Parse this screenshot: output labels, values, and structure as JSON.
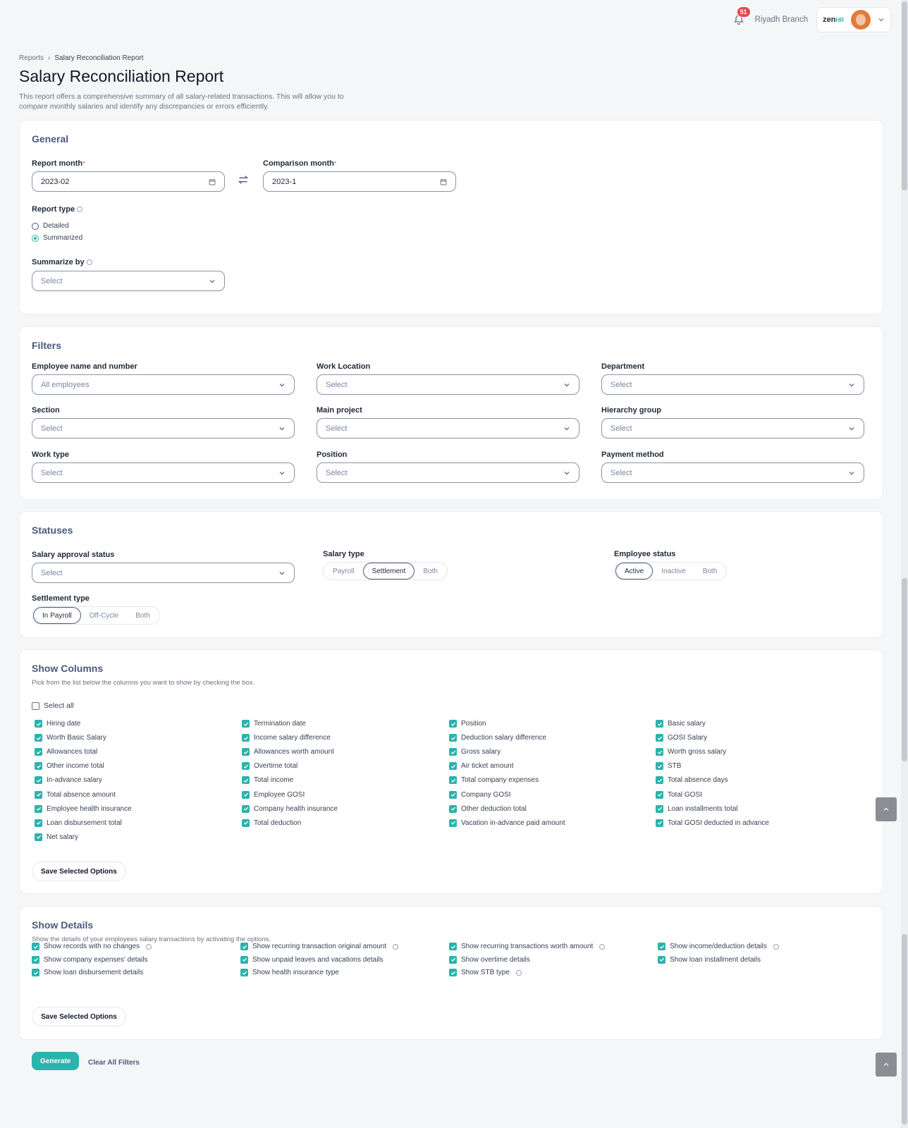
{
  "header": {
    "notif_count": "51",
    "branch": "Riyadh Branch",
    "logo_main": "zen",
    "logo_accent": "HR"
  },
  "breadcrumb": {
    "root": "Reports",
    "current": "Salary Reconciliation Report"
  },
  "page": {
    "title": "Salary Reconciliation Report",
    "description": "This report offers a comprehensive summary of all salary-related transactions. This will allow you to compare monthly salaries and identify any discrepancies or errors efficiently."
  },
  "general": {
    "title": "General",
    "report_month_label": "Report month",
    "report_month_value": "2023-02",
    "comparison_month_label": "Comparison month",
    "comparison_month_value": "2023-1",
    "report_type_label": "Report type",
    "report_type_options": [
      "Detailed",
      "Summarized"
    ],
    "report_type_selected": "Summarized",
    "summarize_by_label": "Summarize by",
    "summarize_by_value": "Select"
  },
  "filters": {
    "title": "Filters",
    "fields": [
      {
        "label": "Employee name and number",
        "value": "All employees"
      },
      {
        "label": "Work Location",
        "value": "Select"
      },
      {
        "label": "Department",
        "value": "Select"
      },
      {
        "label": "Section",
        "value": "Select"
      },
      {
        "label": "Main project",
        "value": "Select"
      },
      {
        "label": "Hierarchy group",
        "value": "Select"
      },
      {
        "label": "Work type",
        "value": "Select"
      },
      {
        "label": "Position",
        "value": "Select"
      },
      {
        "label": "Payment method",
        "value": "Select"
      }
    ]
  },
  "statuses": {
    "title": "Statuses",
    "salary_approval_label": "Salary approval status",
    "salary_approval_value": "Select",
    "salary_type_label": "Salary type",
    "salary_type_options": [
      "Payroll",
      "Settlement",
      "Both"
    ],
    "salary_type_selected": "Settlement",
    "employee_status_label": "Employee status",
    "employee_status_options": [
      "Active",
      "Inactive",
      "Both"
    ],
    "employee_status_selected": "Active",
    "settlement_type_label": "Settlement type",
    "settlement_type_options": [
      "In Payroll",
      "Off-Cycle",
      "Both"
    ],
    "settlement_type_selected": "In Payroll"
  },
  "show_columns": {
    "title": "Show Columns",
    "subtitle": "Pick from the list below the columns you want to show by checking the box.",
    "select_all_label": "Select all",
    "columns": [
      [
        "Hiring date",
        "Worth Basic Salary",
        "Allowances total",
        "Other income total",
        "In-advance salary",
        "Total absence amount",
        "Employee health insurance",
        "Loan disbursement total",
        "Net salary"
      ],
      [
        "Termination date",
        "Income salary difference",
        "Allowances worth amount",
        "Overtime total",
        "Total income",
        "Employee GOSI",
        "Company health insurance",
        "Total deduction"
      ],
      [
        "Position",
        "Deduction salary difference",
        "Gross salary",
        "Air ticket amount",
        "Total company expenses",
        "Company GOSI",
        "Other deduction total",
        "Vacation in-advance paid amount"
      ],
      [
        "Basic salary",
        "GOSI Salary",
        "Worth gross salary",
        "STB",
        "Total absence days",
        "Total GOSI",
        "Loan installments total",
        "Total GOSI deducted in advance"
      ]
    ],
    "save_label": "Save Selected Options"
  },
  "show_details": {
    "title": "Show Details",
    "subtitle": "Show the details of your employees salary transactions by activating the options.",
    "columns": [
      [
        "Show records with no changes",
        "Show company expenses' details",
        "Show loan disbursement details"
      ],
      [
        "Show recurring transaction original amount",
        "Show unpaid leaves and vacations details",
        "Show health insurance type"
      ],
      [
        "Show recurring transactions worth amount",
        "Show overtime details",
        "Show STB type"
      ],
      [
        "Show income/deduction details",
        "Show loan installment details"
      ]
    ],
    "save_label": "Save Selected Options"
  },
  "actions": {
    "generate": "Generate",
    "clear": "Clear All Filters"
  }
}
